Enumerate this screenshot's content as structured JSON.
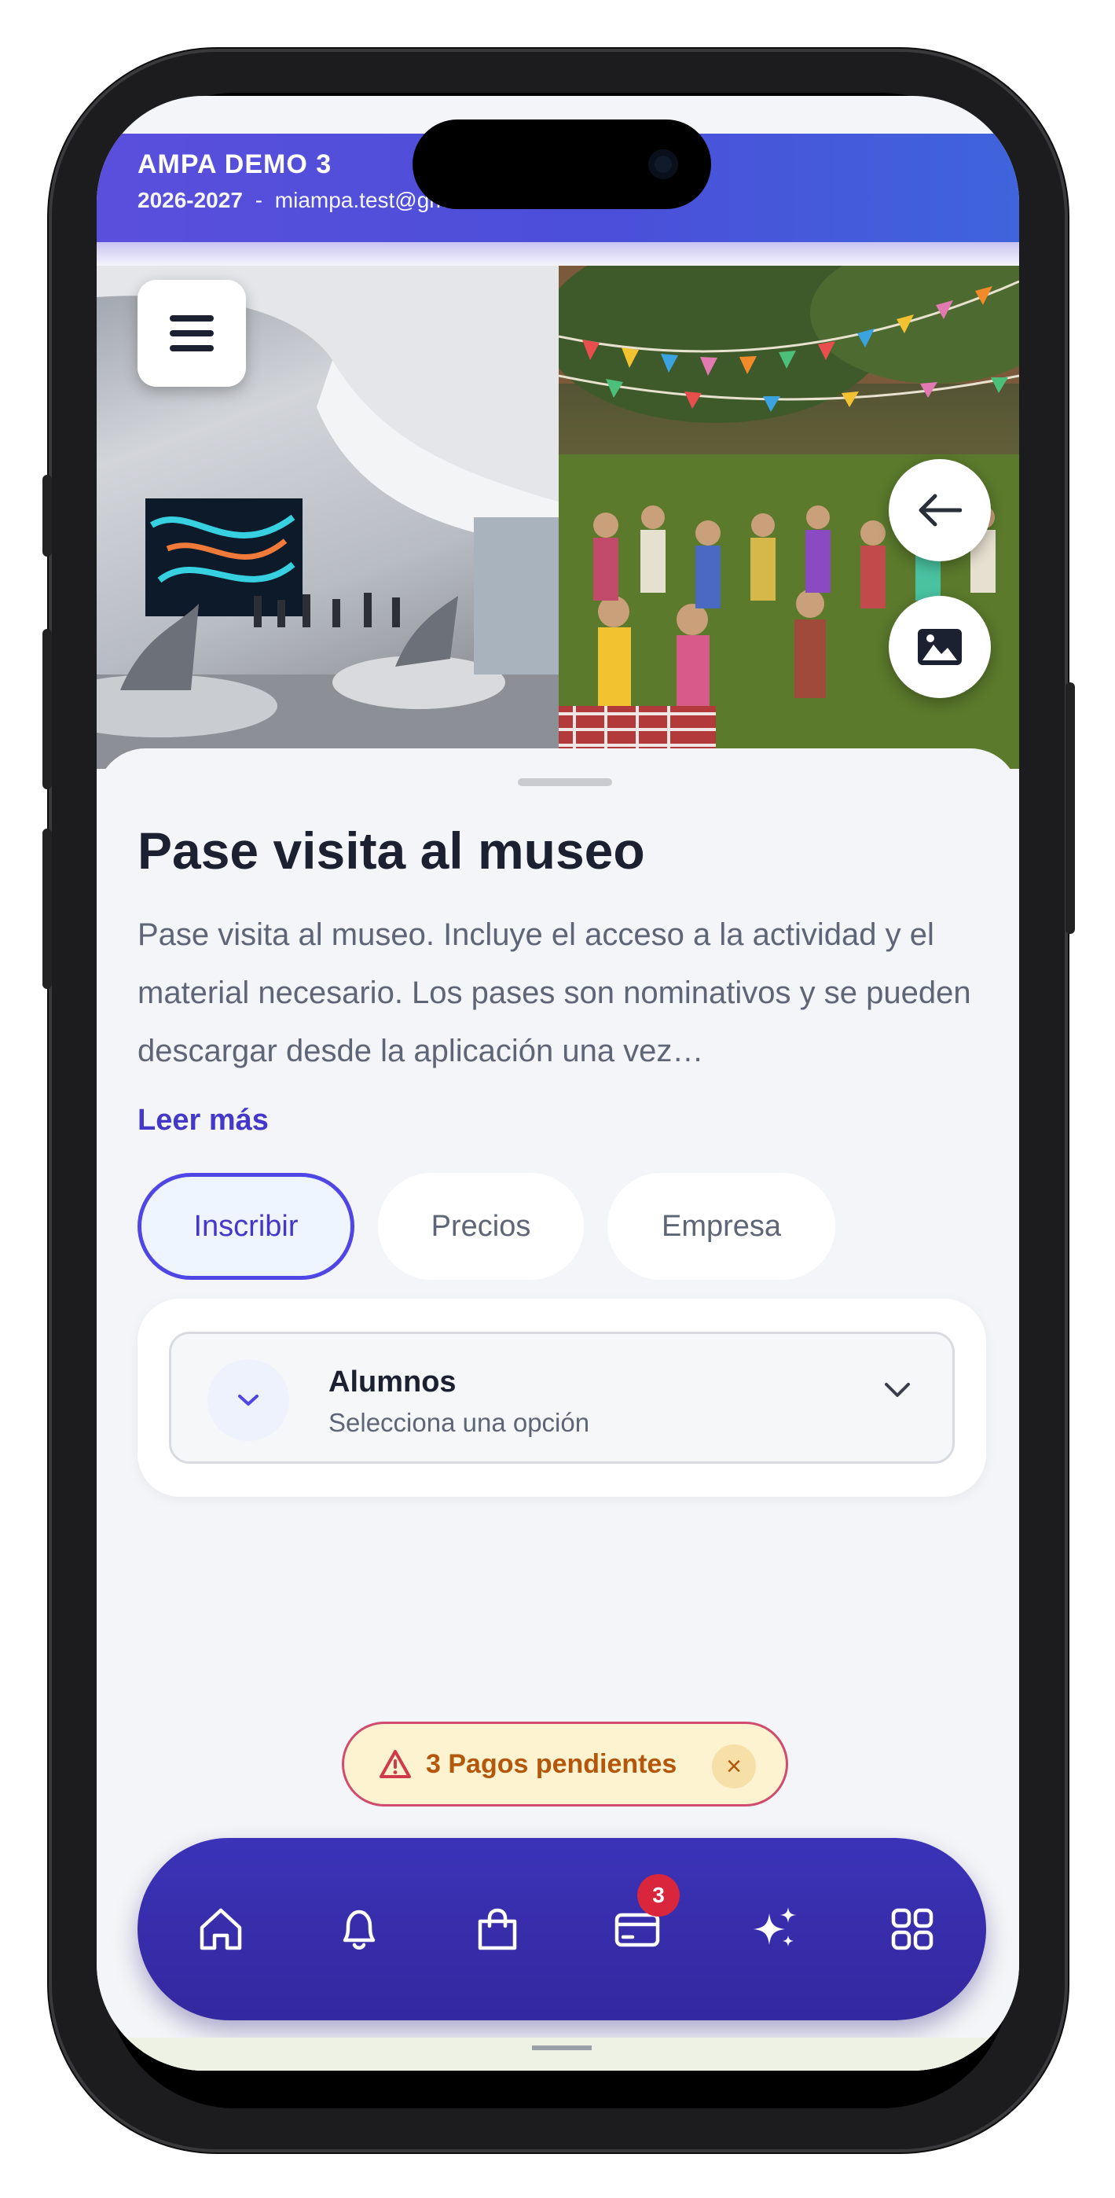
{
  "header": {
    "title": "AMPA DEMO 3",
    "year": "2026-2027",
    "separator": "-",
    "email": "miampa.test@gmail.com"
  },
  "hero": {
    "menu_icon": "hamburger-icon",
    "back_icon": "arrow-left-icon",
    "gallery_icon": "image-icon"
  },
  "activity": {
    "title": "Pase visita al museo",
    "description": "Pase visita al museo. Incluye el acceso a la actividad y el material necesario. Los pases son nominativos y se pueden descargar desde la aplicación una vez…",
    "read_more": "Leer más"
  },
  "tabs": [
    {
      "label": "Inscribir",
      "active": true
    },
    {
      "label": "Precios",
      "active": false
    },
    {
      "label": "Empresa",
      "active": false
    }
  ],
  "select": {
    "label": "Alumnos",
    "value": "Selecciona una opción"
  },
  "pending": {
    "text": "3 Pagos pendientes",
    "close": "×"
  },
  "nav": {
    "items": [
      "home-icon",
      "bell-icon",
      "shopping-bag-icon",
      "credit-card-icon",
      "sparkles-icon",
      "grid-icon"
    ],
    "payments_badge": "3"
  },
  "colors": {
    "accent": "#4f46e5",
    "nav_bg": "#3b33b8",
    "badge": "#d9263d",
    "warning_text": "#b4570b"
  }
}
